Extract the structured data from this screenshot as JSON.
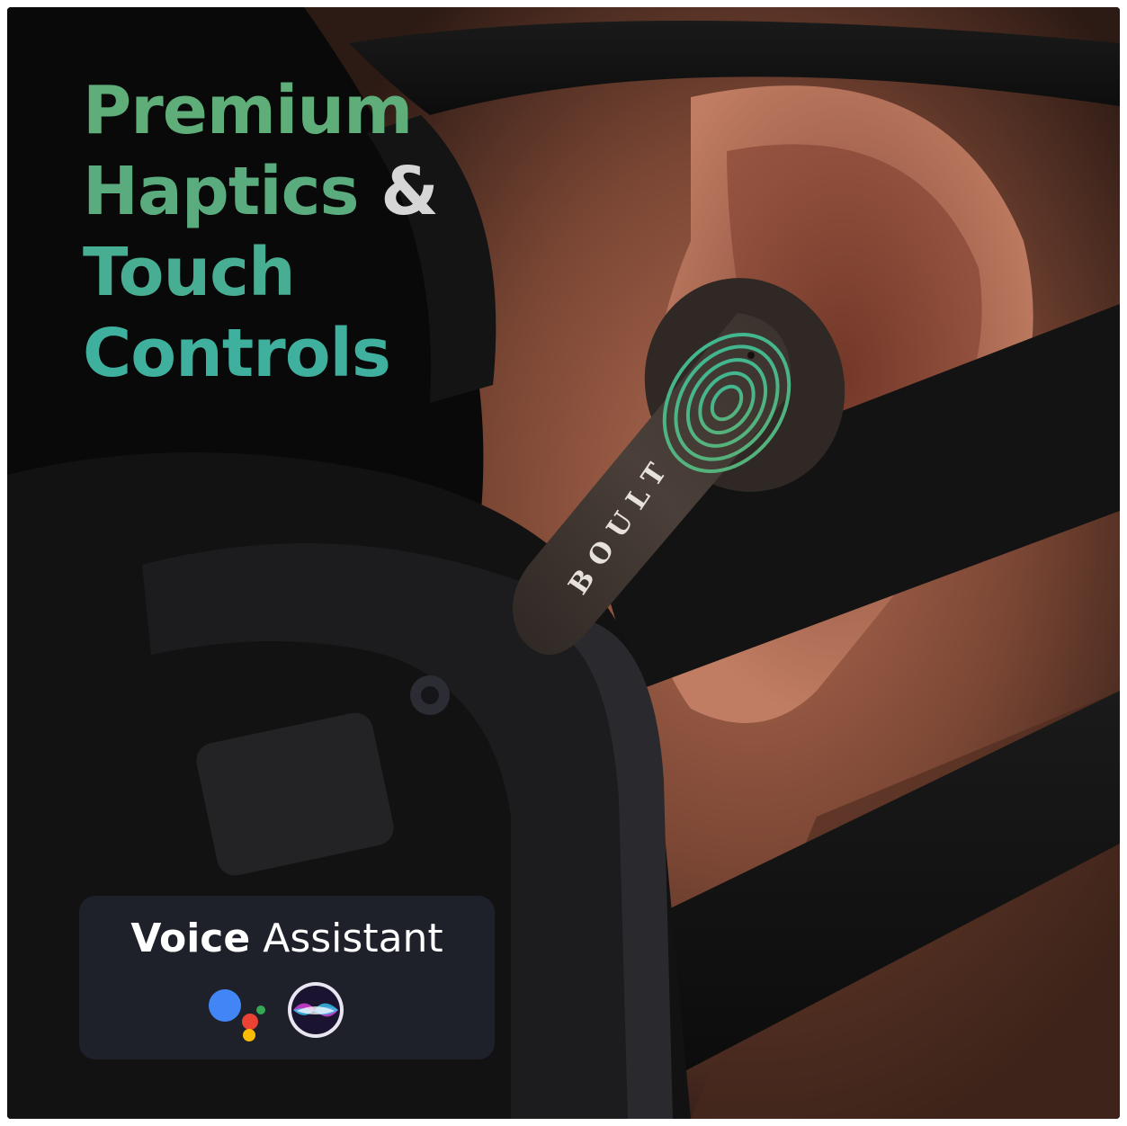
{
  "headline": {
    "line1": "Premium",
    "line2": "Haptics",
    "ampersand": "&",
    "line3": "Touch",
    "line4": "Controls"
  },
  "earbud": {
    "brand": "BOULT"
  },
  "voice_assistant": {
    "bold": "Voice",
    "regular": "Assistant",
    "icons": [
      "google-assistant-icon",
      "siri-icon"
    ]
  },
  "colors": {
    "green": "#5fae7a",
    "teal": "#3fb09e",
    "card": "#20222e"
  }
}
